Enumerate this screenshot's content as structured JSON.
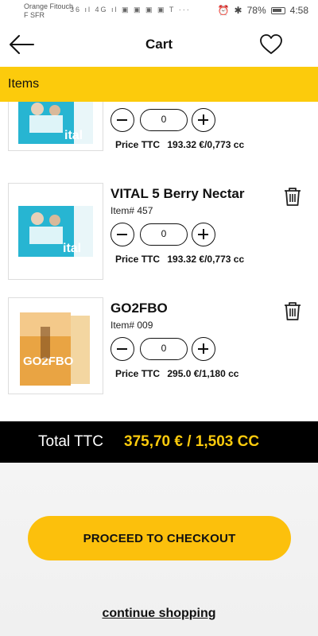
{
  "status_bar": {
    "carrier_line1": "Orange Fitouch",
    "carrier_line2": "F SFR",
    "left_icons": "36 ıl 4G ıl ▣ ▣ ▣ ▣ T ···",
    "battery": "78%",
    "time": "4:58"
  },
  "header": {
    "title": "Cart"
  },
  "section": {
    "label": "Items"
  },
  "items": [
    {
      "name": "",
      "sku": "",
      "qty": "0",
      "price_label": "Price TTC",
      "price": "193.32 €/0,773 cc",
      "image": "vital5-box"
    },
    {
      "name": "VITAL 5 Berry Nectar",
      "sku": "Item# 457",
      "qty": "0",
      "price_label": "Price TTC",
      "price": "193.32 €/0,773 cc",
      "image": "vital5-box"
    },
    {
      "name": "GO2FBO",
      "sku": "Item# 009",
      "qty": "0",
      "price_label": "Price TTC",
      "price": "295.0 €/1,180 cc",
      "image": "go2fbo-box"
    }
  ],
  "total": {
    "label": "Total TTC",
    "value": "375,70 € / 1,503 CC"
  },
  "actions": {
    "checkout": "PROCEED TO CHECKOUT",
    "continue": "continue shopping"
  },
  "colors": {
    "accent": "#fccb0c",
    "total_bar": "#000000",
    "text": "#111111"
  },
  "icons": [
    "back-arrow-icon",
    "heart-icon",
    "trash-icon",
    "minus-icon",
    "plus-icon"
  ]
}
